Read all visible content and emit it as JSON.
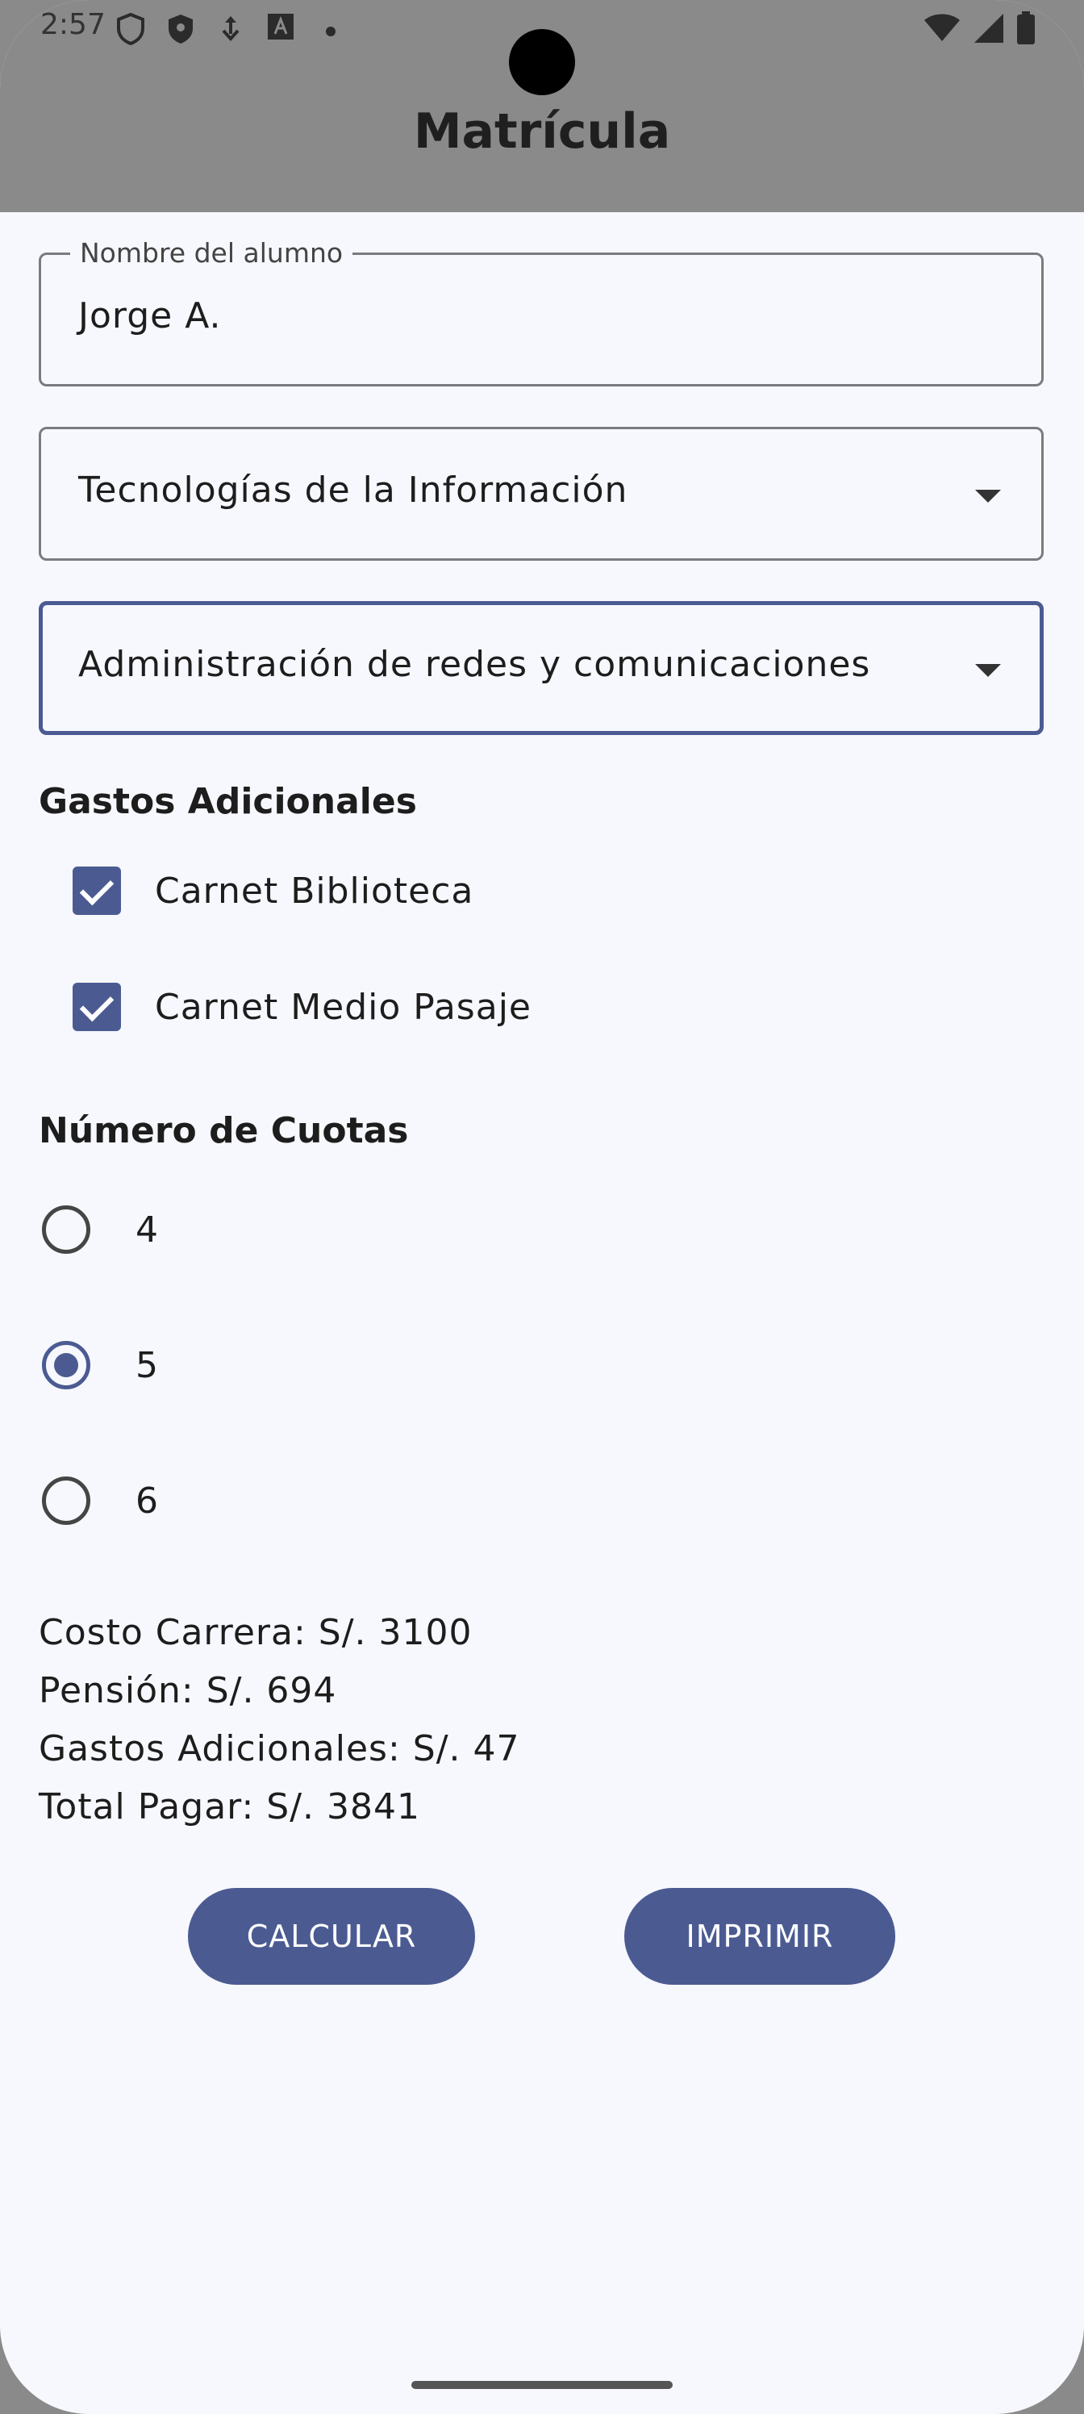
{
  "status_bar": {
    "time": "2:57",
    "icons_left": [
      "shield-outline-icon",
      "shield-icon",
      "usb-debug-icon",
      "font-a-icon",
      "dot-icon"
    ],
    "icons_right": [
      "wifi-icon",
      "signal-icon",
      "battery-icon"
    ]
  },
  "app_bar": {
    "title": "Matrícula"
  },
  "form": {
    "student_name_label": "Nombre del alumno",
    "student_name_value": "Jorge A.",
    "career_area_value": "Tecnologías de la Información",
    "career_value": "Administración de redes y comunicaciones"
  },
  "extras": {
    "title": "Gastos Adicionales",
    "items": [
      {
        "label": "Carnet Biblioteca",
        "checked": true
      },
      {
        "label": "Carnet Medio Pasaje",
        "checked": true
      }
    ]
  },
  "installments": {
    "title": "Número de Cuotas",
    "options": [
      {
        "label": "4",
        "selected": false
      },
      {
        "label": "5",
        "selected": true
      },
      {
        "label": "6",
        "selected": false
      }
    ]
  },
  "results": {
    "career_cost": "Costo Carrera: S/. 3100",
    "pension": "Pensión: S/. 694",
    "extra_costs": "Gastos Adicionales: S/. 47",
    "total": "Total Pagar: S/. 3841"
  },
  "buttons": {
    "calculate": "CALCULAR",
    "print": "IMPRIMIR"
  },
  "colors": {
    "accent": "#4b5b92",
    "app_bar": "#8a8a8a",
    "background": "#f7f8fd"
  }
}
